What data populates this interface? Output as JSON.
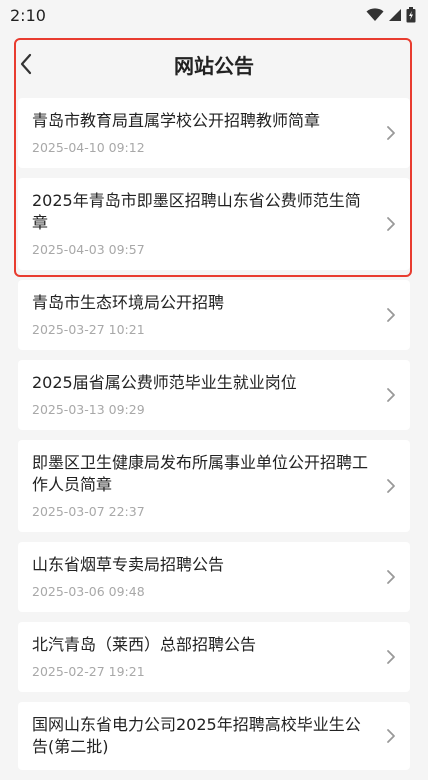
{
  "status_bar": {
    "time": "2:10"
  },
  "header": {
    "title": "网站公告"
  },
  "notices": [
    {
      "title": "青岛市教育局直属学校公开招聘教师简章",
      "date": "2025-04-10 09:12"
    },
    {
      "title": "2025年青岛市即墨区招聘山东省公费师范生简章",
      "date": "2025-04-03 09:57"
    },
    {
      "title": "青岛市生态环境局公开招聘",
      "date": "2025-03-27 10:21"
    },
    {
      "title": "2025届省属公费师范毕业生就业岗位",
      "date": "2025-03-13 09:29"
    },
    {
      "title": "即墨区卫生健康局发布所属事业单位公开招聘工作人员简章",
      "date": "2025-03-07 22:37"
    },
    {
      "title": "山东省烟草专卖局招聘公告",
      "date": "2025-03-06 09:48"
    },
    {
      "title": "北汽青岛（莱西）总部招聘公告",
      "date": "2025-02-27 19:21"
    },
    {
      "title": "国网山东省电力公司2025年招聘高校毕业生公告(第二批)",
      "date": ""
    }
  ],
  "colors": {
    "highlight": "#e83c2f",
    "background": "#f5f5f5",
    "card": "#ffffff",
    "date": "#a8a8a8"
  }
}
